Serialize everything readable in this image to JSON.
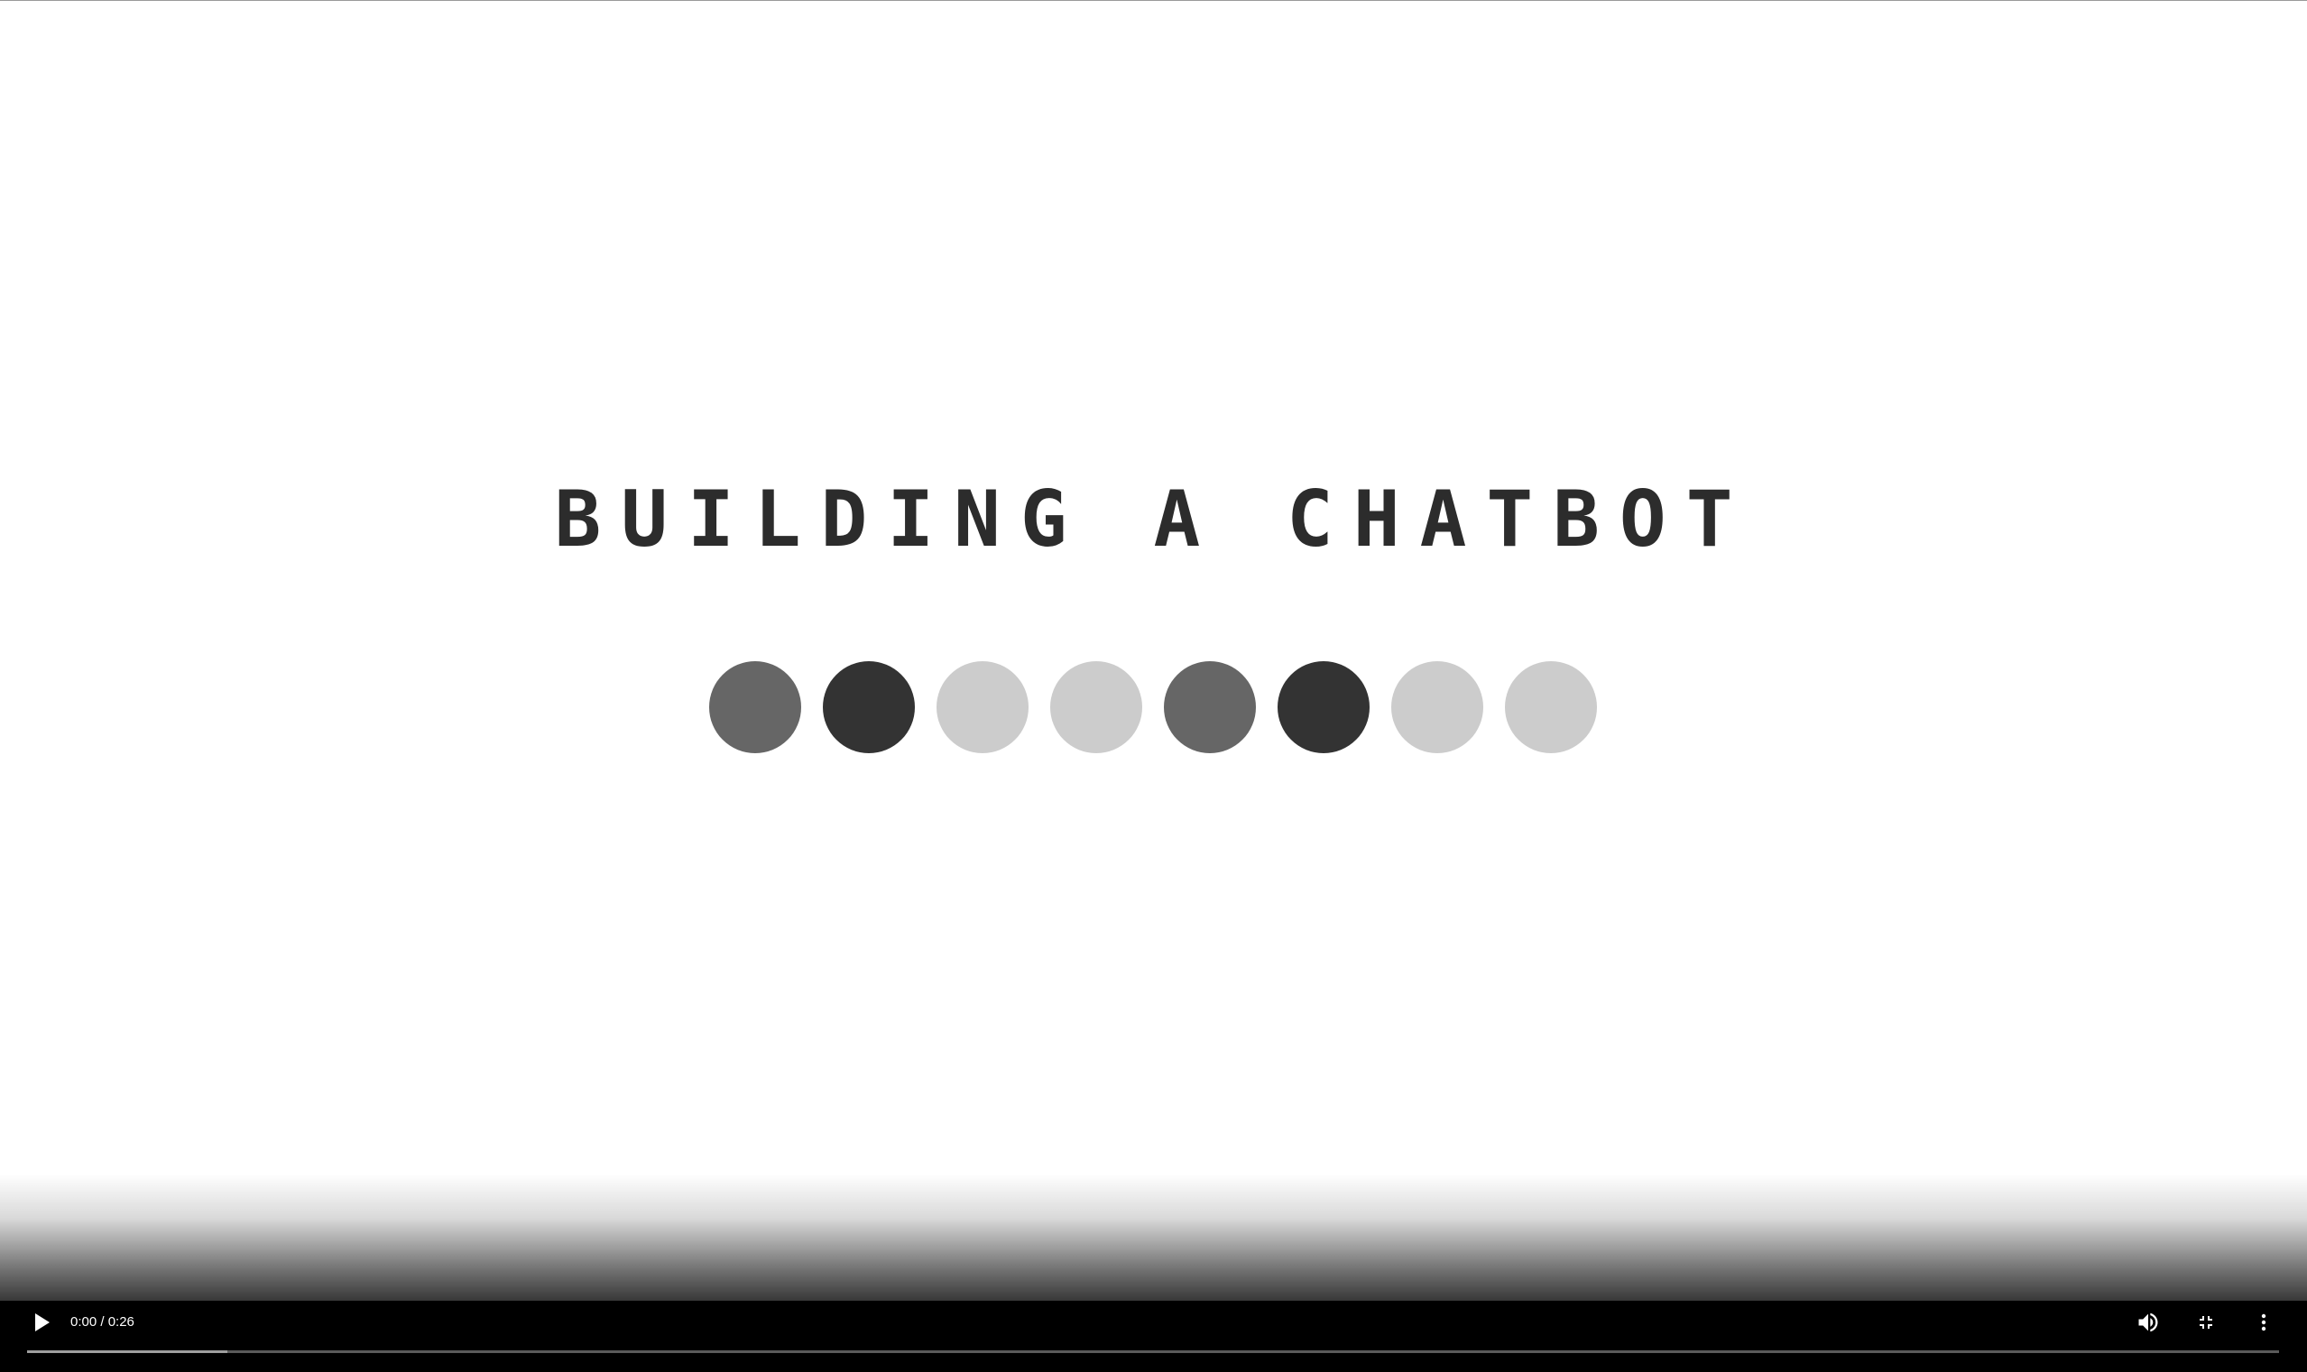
{
  "video": {
    "title_text": "BUILDING A CHATBOT",
    "dots": [
      {
        "color": "#666666"
      },
      {
        "color": "#333333"
      },
      {
        "color": "#cccccc"
      },
      {
        "color": "#cccccc"
      },
      {
        "color": "#666666"
      },
      {
        "color": "#333333"
      },
      {
        "color": "#cccccc"
      },
      {
        "color": "#cccccc"
      }
    ]
  },
  "controls": {
    "play_icon": "play-icon",
    "time_display": "0:00 / 0:26",
    "volume_icon": "volume-icon",
    "fullscreen_icon": "exit-fullscreen-icon",
    "menu_icon": "more-vert-icon",
    "progress_played_fraction": 0.0,
    "progress_buffered_fraction": 0.089
  },
  "colors": {
    "control_bar": "#000000",
    "title": "#2c2c2c"
  }
}
